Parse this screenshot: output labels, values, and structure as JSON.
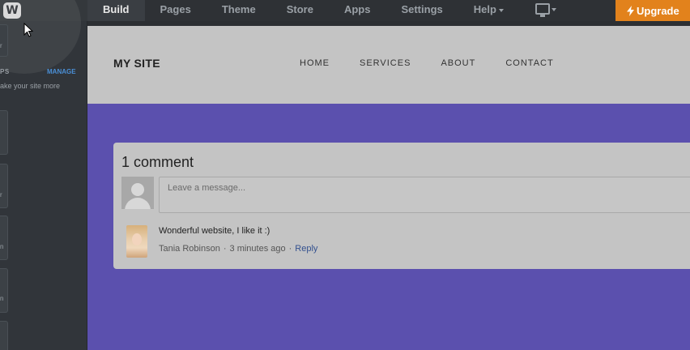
{
  "topbar": {
    "logo_letter": "W",
    "nav": [
      "Build",
      "Pages",
      "Theme",
      "Store",
      "Apps",
      "Settings",
      "Help"
    ],
    "active": "Build",
    "upgrade_label": "Upgrade",
    "icons": {
      "device": "monitor-icon",
      "upgrade": "lightning-icon"
    }
  },
  "sidebar": {
    "apps_label": "PS",
    "manage_label": "MANAGE",
    "more_text": "ake your site more",
    "box_labels": [
      "r",
      "r",
      "n",
      "n"
    ]
  },
  "site": {
    "title": "MY SITE",
    "nav": [
      "HOME",
      "SERVICES",
      "ABOUT",
      "CONTACT"
    ]
  },
  "comments": {
    "title": "1 comment",
    "placeholder": "Leave a message...",
    "items": [
      {
        "text": "Wonderful website, I like it :)",
        "author": "Tania Robinson",
        "time": "3 minutes ago",
        "reply": "Reply"
      }
    ]
  },
  "colors": {
    "accent": "#e2821c",
    "hero": "#5b50ae",
    "link": "#4a8fd6"
  }
}
